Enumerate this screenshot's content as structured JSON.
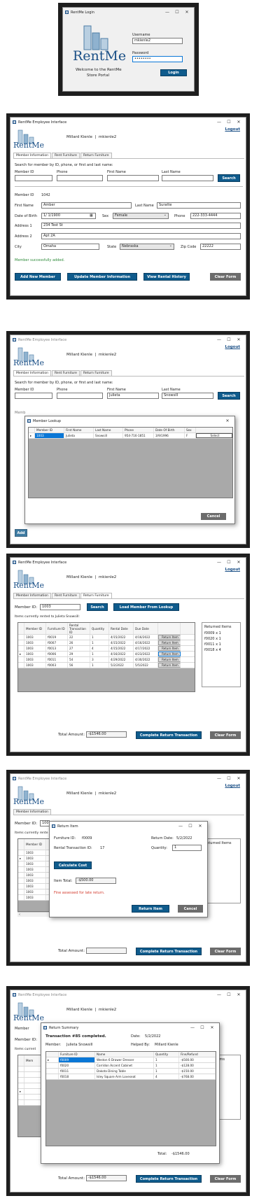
{
  "login": {
    "title": "RentMe Login",
    "logo_text": "RentMe",
    "welcome_line1": "Welcome to the RentMe",
    "welcome_line2": "Store Portal",
    "username_label": "Username",
    "username_value": "mkienle2",
    "password_label": "Password",
    "password_value": "••••••••",
    "login_button": "Login"
  },
  "app": {
    "title": "RentMe Employee Interface",
    "logo_text": "RentMe",
    "user_name": "Millard Kienle",
    "divider": "|",
    "username": "mkienle2",
    "logout": "Logout",
    "tabs": [
      "Member Information",
      "Rent Furniture",
      "Return Furniture"
    ]
  },
  "member_info": {
    "search_prompt": "Search for member by ID, phone, or first and last name:",
    "labels": {
      "member_id": "Member ID",
      "phone": "Phone",
      "first_name": "First Name",
      "last_name": "Last Name",
      "dob": "Date of Birth",
      "sex": "Sex",
      "address1": "Address 1",
      "address2": "Address 2",
      "city": "City",
      "state": "State",
      "zip": "Zip Code"
    },
    "search_button": "Search",
    "member": {
      "id": "1042",
      "first_name": "Amber",
      "last_name": "Suratte",
      "dob": "1/  1/1900",
      "sex": "Female",
      "phone": "222-333-4444",
      "address1": "234 Test St",
      "address2": "Apt 2A",
      "city": "Omaha",
      "state": "Nebraska",
      "zip": "22222"
    },
    "status": "Member successfully added.",
    "buttons": {
      "add": "Add New Member",
      "update": "Update Member Information",
      "history": "View Rental History",
      "clear": "Clear Form"
    }
  },
  "lookup": {
    "search_first": "Julieta",
    "search_last": "Snowsill",
    "dialog_title": "Member Lookup",
    "columns": [
      "Member ID",
      "First Name",
      "Last Name",
      "Phone",
      "Date Of Birth",
      "Sex"
    ],
    "rows": [
      {
        "id": "1003",
        "first": "Julieta",
        "last": "Snowsill",
        "phone": "954-716-1851",
        "dob": "3/9/1996",
        "sex": "F",
        "action": "Select"
      }
    ],
    "cancel": "Cancel"
  },
  "return_furniture": {
    "member_id_label": "Member ID:",
    "member_id_value": "1003",
    "search_button": "Search",
    "load_button": "Load Member From Lookup",
    "items_caption": "Items currently rented to Julieta Snowsill:",
    "columns": [
      "Member ID",
      "Furniture ID",
      "Rental Transaction ID",
      "Quantity",
      "Rental Date",
      "Due Date",
      ""
    ],
    "rows": [
      {
        "member": "1003",
        "furniture": "f0019",
        "rtid": "22",
        "qty": "1",
        "rdate": "4/15/2022",
        "due": "4/16/2022",
        "action": "Return Item"
      },
      {
        "member": "1003",
        "furniture": "f0007",
        "rtid": "26",
        "qty": "1",
        "rdate": "4/15/2022",
        "due": "4/16/2022",
        "action": "Return Item"
      },
      {
        "member": "1003",
        "furniture": "f0013",
        "rtid": "27",
        "qty": "4",
        "rdate": "4/15/2022",
        "due": "4/17/2022",
        "action": "Return Item"
      },
      {
        "member": "1003",
        "furniture": "f0006",
        "rtid": "29",
        "qty": "1",
        "rdate": "4/16/2022",
        "due": "4/23/2022",
        "action": "Return Item"
      },
      {
        "member": "1003",
        "furniture": "f0011",
        "rtid": "54",
        "qty": "3",
        "rdate": "4/29/2022",
        "due": "4/30/2022",
        "action": "Return Item"
      },
      {
        "member": "1003",
        "furniture": "f0003",
        "rtid": "56",
        "qty": "1",
        "rdate": "5/2/2022",
        "due": "5/5/2022",
        "action": "Return Item"
      }
    ],
    "returned_title": "Returned Items",
    "returned_items": [
      "f0009 x 1",
      "f0020 x 1",
      "f0011 x 1",
      "f0018 x 4"
    ],
    "total_label": "Total Amount:",
    "total_value": "-$1546.00",
    "complete_button": "Complete Return Transaction",
    "clear_button": "Clear Form"
  },
  "return_item": {
    "title": "Return Item",
    "furniture_label": "Furniture ID:",
    "furniture_value": "f0009",
    "return_date_label": "Return Date:",
    "return_date_value": "5/2/2022",
    "rtid_label": "Rental Transaction ID:",
    "rtid_value": "17",
    "quantity_label": "Quantity:",
    "quantity_value": "1",
    "calc_button": "Calculate Cost",
    "item_total_label": "Item Total:",
    "item_total_value": "-$500.00",
    "fine_message": "Fine assessed for late return.",
    "return_button": "Return Item",
    "cancel_button": "Cancel",
    "bg_member_id_prefix": "100",
    "bg_items_caption": "Items currently rente",
    "bg_col": "Member ID",
    "bg_member": "1003",
    "bg_returned": "Returned Items"
  },
  "summary": {
    "title": "Return Summary",
    "heading": "Transaction #85 completed.",
    "date_label": "Date:",
    "date_value": "5/2/2022",
    "member_label": "Member:",
    "member_value": "Julieta Snowsill",
    "helped_label": "Helped By:",
    "helped_value": "Millard Kienle",
    "columns": [
      "Furniture ID",
      "Name",
      "Quantity",
      "Fine/Refund"
    ],
    "rows": [
      {
        "id": "f0009",
        "name": "Weston 6 Drawer Dresser",
        "qty": "1",
        "amt": "-$500.00"
      },
      {
        "id": "f0020",
        "name": "Corridon Accent Cabinet",
        "qty": "1",
        "amt": "-$128.00"
      },
      {
        "id": "f0011",
        "name": "Dakota Dining Table",
        "qty": "1",
        "amt": "-$150.00"
      },
      {
        "id": "f0018",
        "name": "Isley Square Arm Loveseat",
        "qty": "4",
        "amt": "-$768.00"
      }
    ],
    "total_label": "Total:",
    "total_value": "-$1546.00",
    "bg_member": "Member",
    "bg_items": "Items current",
    "bg_col": "Mem",
    "bg_returned": "Items",
    "bg_counts": [
      "1",
      "1",
      "1",
      "4"
    ]
  },
  "colors": {
    "primary": "#0f5b8c",
    "grey_button": "#6c6c6c",
    "status_green": "#2e8b3a",
    "error_red": "#d33c2f",
    "selection": "#0a77d6"
  }
}
